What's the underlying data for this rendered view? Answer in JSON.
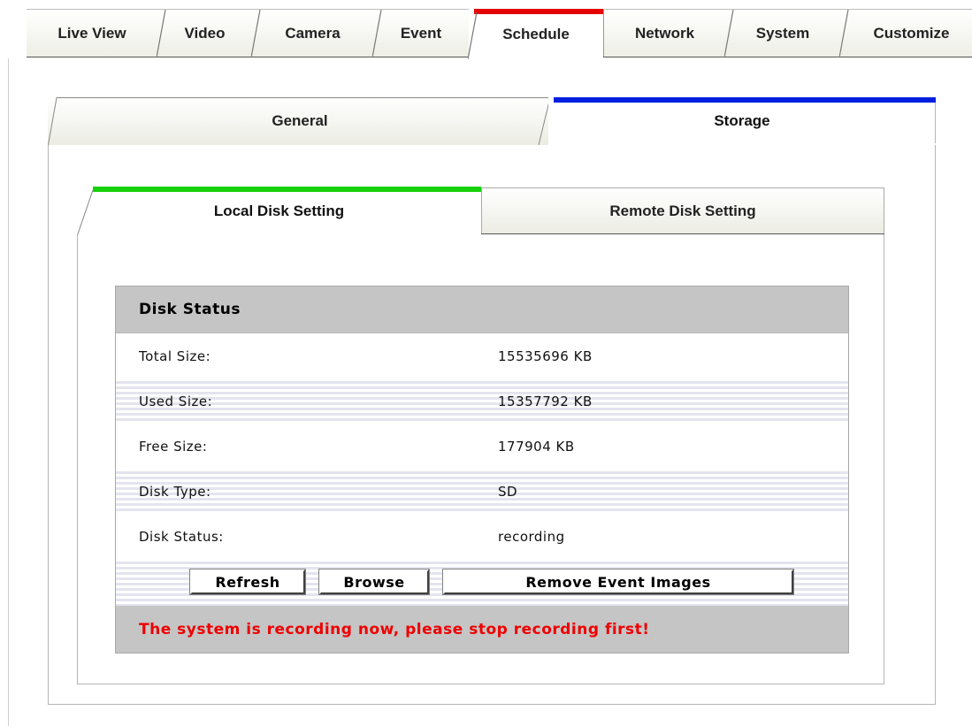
{
  "top_nav": {
    "tabs": [
      {
        "label": "Live View"
      },
      {
        "label": "Video"
      },
      {
        "label": "Camera"
      },
      {
        "label": "Event"
      },
      {
        "label": "Schedule"
      },
      {
        "label": "Network"
      },
      {
        "label": "System"
      },
      {
        "label": "Customize"
      }
    ],
    "active": "Schedule",
    "active_color": "#e60000"
  },
  "section_tabs": {
    "general": "General",
    "storage": "Storage",
    "active": "Storage",
    "active_color": "#0020e0"
  },
  "storage_tabs": {
    "local": "Local Disk Setting",
    "remote": "Remote Disk Setting",
    "active": "Local Disk Setting",
    "active_color": "#16d00c"
  },
  "disk_status": {
    "title": "Disk Status",
    "rows": [
      {
        "label": "Total Size:",
        "value": "15535696 KB"
      },
      {
        "label": "Used Size:",
        "value": "15357792 KB"
      },
      {
        "label": "Free Size:",
        "value": "177904 KB"
      },
      {
        "label": "Disk Type:",
        "value": "SD"
      },
      {
        "label": "Disk Status:",
        "value": "recording"
      }
    ],
    "buttons": {
      "refresh": "Refresh",
      "browse": "Browse",
      "remove": "Remove Event Images"
    },
    "warning": "The system is recording now, please stop recording first!",
    "warning_color": "#ee0000"
  }
}
